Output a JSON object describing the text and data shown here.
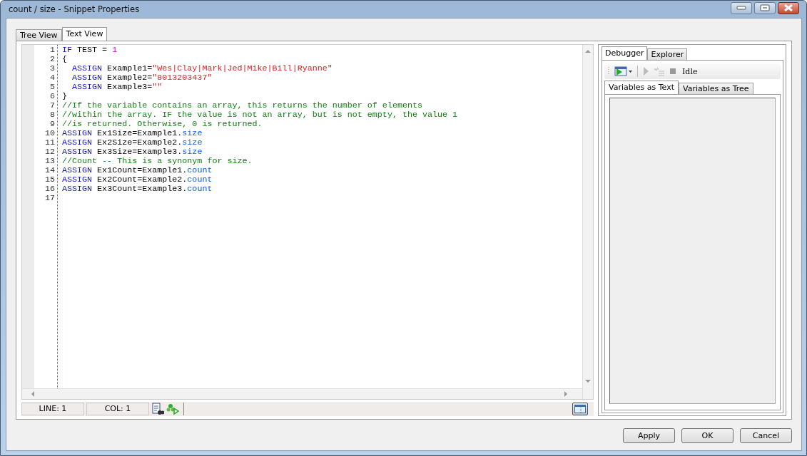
{
  "window": {
    "title": "count / size - Snippet Properties"
  },
  "tabs": [
    {
      "label": "Tree View",
      "selected": false
    },
    {
      "label": "Text View",
      "selected": true
    }
  ],
  "editor": {
    "lines": [
      {
        "number": "1",
        "tokens": [
          {
            "kind": "keyword",
            "text": "IF"
          },
          {
            "kind": "plain",
            "text": " TEST = "
          },
          {
            "kind": "number",
            "text": "1"
          }
        ]
      },
      {
        "number": "2",
        "tokens": [
          {
            "kind": "plain",
            "text": "{"
          }
        ]
      },
      {
        "number": "3",
        "tokens": [
          {
            "kind": "keyword",
            "text": "  ASSIGN"
          },
          {
            "kind": "plain",
            "text": " Example1="
          },
          {
            "kind": "string",
            "text": "\"Wes|Clay|Mark|Jed|Mike|Bill|Ryanne\""
          }
        ]
      },
      {
        "number": "4",
        "tokens": [
          {
            "kind": "keyword",
            "text": "  ASSIGN"
          },
          {
            "kind": "plain",
            "text": " Example2="
          },
          {
            "kind": "string",
            "text": "\"8013203437\""
          }
        ]
      },
      {
        "number": "5",
        "tokens": [
          {
            "kind": "keyword",
            "text": "  ASSIGN"
          },
          {
            "kind": "plain",
            "text": " Example3="
          },
          {
            "kind": "string",
            "text": "\"\""
          }
        ]
      },
      {
        "number": "6",
        "tokens": [
          {
            "kind": "plain",
            "text": "}"
          }
        ]
      },
      {
        "number": "7",
        "tokens": [
          {
            "kind": "comment",
            "text": "//If the variable contains an array, this returns the number of elements"
          }
        ]
      },
      {
        "number": "8",
        "tokens": [
          {
            "kind": "comment",
            "text": "//within the array. IF the value is not an array, but is not empty, the value 1"
          }
        ]
      },
      {
        "number": "9",
        "tokens": [
          {
            "kind": "comment",
            "text": "//is returned. Otherwise, 0 is returned."
          }
        ]
      },
      {
        "number": "10",
        "tokens": [
          {
            "kind": "keyword",
            "text": "ASSIGN"
          },
          {
            "kind": "plain",
            "text": " Ex1Size=Example1."
          },
          {
            "kind": "property",
            "text": "size"
          }
        ]
      },
      {
        "number": "11",
        "tokens": [
          {
            "kind": "keyword",
            "text": "ASSIGN"
          },
          {
            "kind": "plain",
            "text": " Ex2Size=Example2."
          },
          {
            "kind": "property",
            "text": "size"
          }
        ]
      },
      {
        "number": "12",
        "tokens": [
          {
            "kind": "keyword",
            "text": "ASSIGN"
          },
          {
            "kind": "plain",
            "text": " Ex3Size=Example3."
          },
          {
            "kind": "property",
            "text": "size"
          }
        ]
      },
      {
        "number": "13",
        "tokens": [
          {
            "kind": "comment",
            "text": "//Count -- This is a synonym for size."
          }
        ]
      },
      {
        "number": "14",
        "tokens": [
          {
            "kind": "keyword",
            "text": "ASSIGN"
          },
          {
            "kind": "plain",
            "text": " Ex1Count=Example1."
          },
          {
            "kind": "property",
            "text": "count"
          }
        ]
      },
      {
        "number": "15",
        "tokens": [
          {
            "kind": "keyword",
            "text": "ASSIGN"
          },
          {
            "kind": "plain",
            "text": " Ex2Count=Example2."
          },
          {
            "kind": "property",
            "text": "count"
          }
        ]
      },
      {
        "number": "16",
        "tokens": [
          {
            "kind": "keyword",
            "text": "ASSIGN"
          },
          {
            "kind": "plain",
            "text": " Ex3Count=Example3."
          },
          {
            "kind": "property",
            "text": "count"
          }
        ]
      },
      {
        "number": "17"
      }
    ]
  },
  "status_bar": {
    "line": "LINE: 1",
    "col": "COL: 1"
  },
  "side_tabs": [
    {
      "label": "Debugger",
      "selected": true
    },
    {
      "label": "Explorer",
      "selected": false
    }
  ],
  "debugger": {
    "state": "Idle",
    "tabs": [
      {
        "label": "Variables as Text",
        "selected": true
      },
      {
        "label": "Variables as Tree",
        "selected": false
      }
    ]
  },
  "buttons": [
    "Apply",
    "OK",
    "Cancel"
  ]
}
